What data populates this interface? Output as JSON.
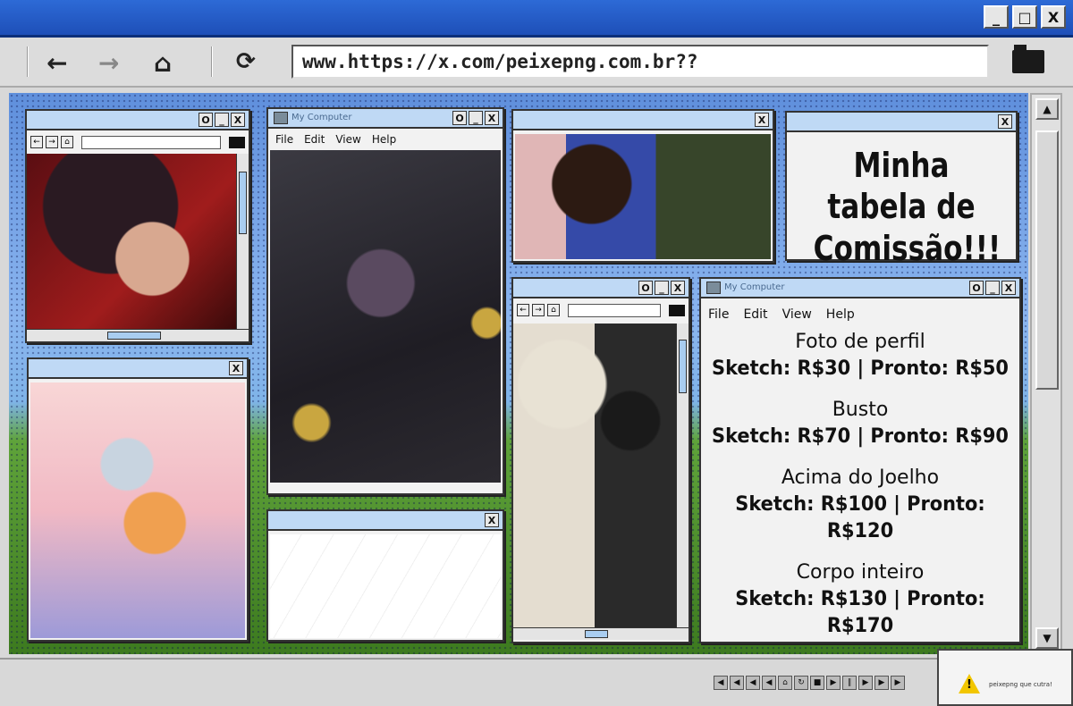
{
  "window_buttons": [
    "_",
    "□",
    "X"
  ],
  "toolbar": {
    "back": "←",
    "forward": "→",
    "home": "⌂",
    "refresh": "⟳",
    "url": "www.https://x.com/peixepng.com.br??"
  },
  "windows": {
    "w1": {
      "buttons": [
        "O",
        "_",
        "X"
      ]
    },
    "w2": {
      "title": "My Computer",
      "menu": [
        "File",
        "Edit",
        "View",
        "Help"
      ],
      "buttons": [
        "O",
        "_",
        "X"
      ]
    },
    "w3": {
      "buttons": [
        "X"
      ]
    },
    "w4": {
      "title_text": "Minha tabela de Comissão!!!",
      "buttons": [
        "X"
      ]
    },
    "w5": {
      "buttons": [
        "X"
      ]
    },
    "w6": {
      "buttons": [
        "X"
      ]
    },
    "w7": {
      "buttons": [
        "O",
        "_",
        "X"
      ]
    },
    "w8": {
      "title": "My Computer",
      "menu": [
        "File",
        "Edit",
        "View",
        "Help"
      ],
      "buttons": [
        "O",
        "_",
        "X"
      ]
    }
  },
  "price_list": [
    {
      "name": "Foto de perfil",
      "price": "Sketch: R$30 | Pronto: R$50"
    },
    {
      "name": "Busto",
      "price": "Sketch: R$70 | Pronto: R$90"
    },
    {
      "name": "Acima do Joelho",
      "price": "Sketch: R$100 | Pronto: R$120"
    },
    {
      "name": "Corpo inteiro",
      "price": "Sketch: R$130 | Pronto: R$170"
    }
  ],
  "warning": {
    "text": "peixepng que cutra!"
  }
}
